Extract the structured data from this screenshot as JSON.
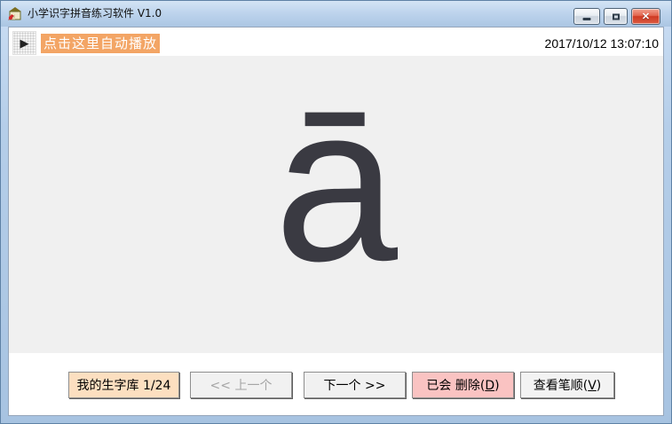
{
  "window": {
    "title": "小学识字拼音练习软件 V1.0",
    "controls": [
      {
        "name": "minimize",
        "glyph": "—"
      },
      {
        "name": "maximize",
        "glyph": "▢"
      },
      {
        "name": "close",
        "glyph": "✕"
      }
    ]
  },
  "toolbar": {
    "play_icon": "▶",
    "autoplay_label": "点击这里自动播放",
    "datetime": "2017/10/12 13:07:10"
  },
  "main": {
    "pinyin": "ā"
  },
  "footer": {
    "buttons": [
      {
        "id": "wordbank",
        "label": "我的生字库 1/24",
        "bg": "#fcdfc0",
        "state": "normal"
      },
      {
        "id": "previous",
        "label": "<< 上一个",
        "bg": "#f1f1f1",
        "state": "disabled"
      },
      {
        "id": "next",
        "label": "下一个 >>",
        "bg": "#f1f1f1",
        "state": "normal"
      },
      {
        "id": "delete-known",
        "prefix": "已会 删除(",
        "mnemonic": "D",
        "suffix": ")",
        "bg": "#fac3c2",
        "state": "normal"
      },
      {
        "id": "view-strokes",
        "prefix": "查看笔顺(",
        "mnemonic": "V",
        "suffix": ")",
        "bg": "#f3f3f3",
        "state": "normal"
      }
    ]
  },
  "colors": {
    "titlebar_top": "#d4e4f5",
    "titlebar_bottom": "#abc6e3",
    "client_main_bg": "#f0f0f0",
    "accent_orange": "#f3a565",
    "pinyin_glyph": "#3a3a42",
    "close_button_red": "#cf3a23",
    "disabled_text": "#a5a5a5"
  }
}
